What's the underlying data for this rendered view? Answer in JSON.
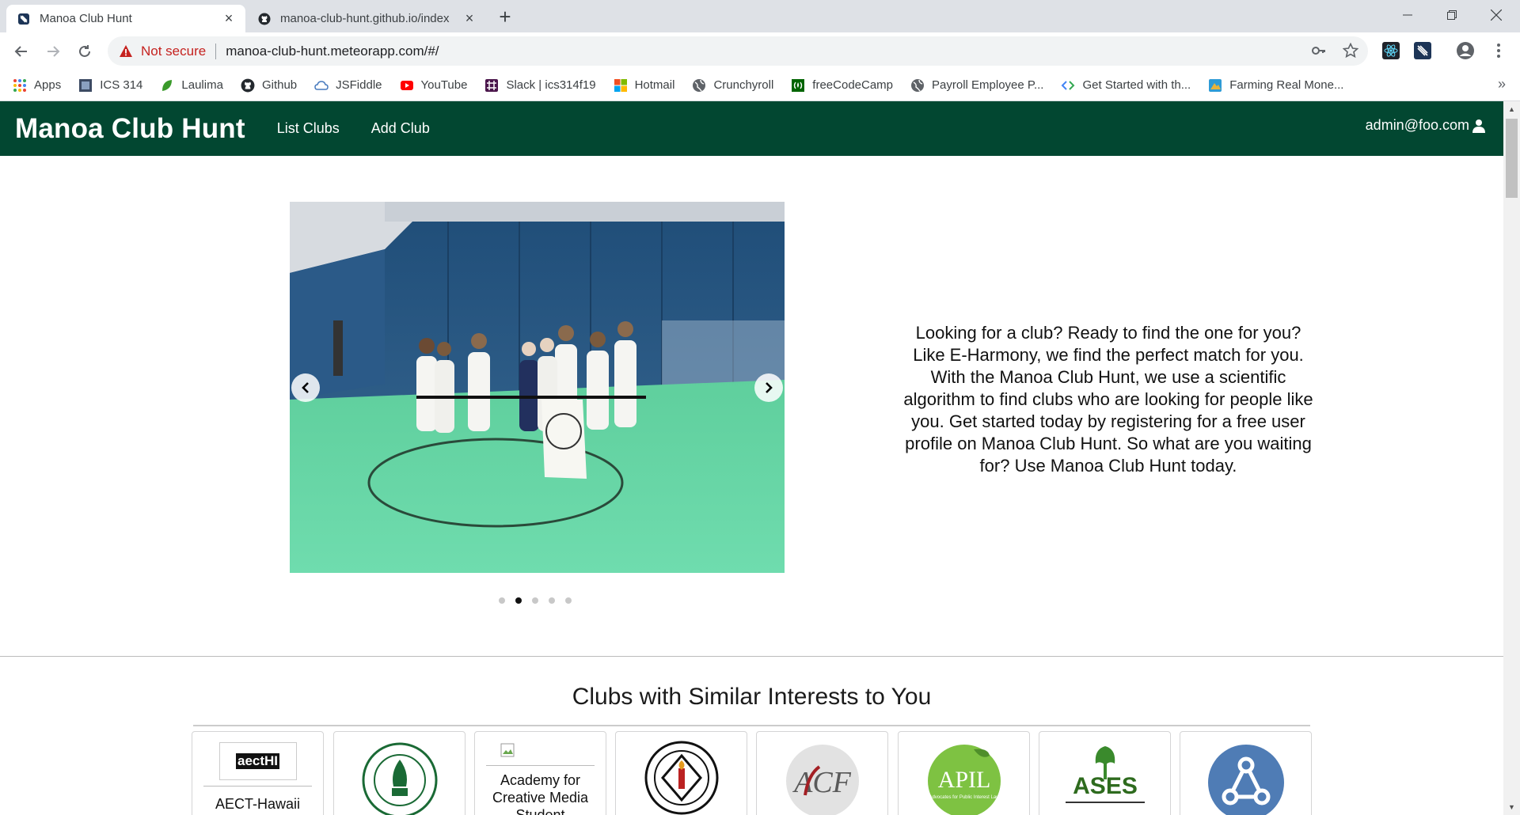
{
  "browser": {
    "tabs": [
      {
        "title": "Manoa Club Hunt",
        "icon": "meteor-favicon-icon",
        "active": true
      },
      {
        "title": "manoa-club-hunt.github.io/index",
        "icon": "github-icon",
        "active": false
      }
    ],
    "address": {
      "security_label": "Not secure",
      "url": "manoa-club-hunt.meteorapp.com/#/"
    },
    "bookmarks": [
      {
        "label": "Apps",
        "icon": "apps-grid-icon"
      },
      {
        "label": "ICS 314",
        "icon": "page-icon"
      },
      {
        "label": "Laulima",
        "icon": "leaf-icon"
      },
      {
        "label": "Github",
        "icon": "github-icon"
      },
      {
        "label": "JSFiddle",
        "icon": "cloud-icon"
      },
      {
        "label": "YouTube",
        "icon": "youtube-icon"
      },
      {
        "label": "Slack | ics314f19",
        "icon": "slack-icon"
      },
      {
        "label": "Hotmail",
        "icon": "microsoft-icon"
      },
      {
        "label": "Crunchyroll",
        "icon": "globe-icon"
      },
      {
        "label": "freeCodeCamp",
        "icon": "fcc-icon"
      },
      {
        "label": "Payroll Employee P...",
        "icon": "globe-icon"
      },
      {
        "label": "Get Started with th...",
        "icon": "code-icon"
      },
      {
        "label": "Farming Real Mone...",
        "icon": "game-icon"
      }
    ],
    "bookmarks_overflow": "»"
  },
  "site": {
    "brand": "Manoa Club Hunt",
    "nav": [
      "List Clubs",
      "Add Club"
    ],
    "user": "admin@foo.com",
    "carousel": {
      "slide_count": 5,
      "active_slide": 2
    },
    "blurb": "Looking for a club? Ready to find the one for you? Like E-Harmony, we find the perfect match for you. With the Manoa Club Hunt, we use a scientific algorithm to find clubs who are looking for people like you. Get started today by registering for a free user profile on Manoa Club Hunt. So what are you waiting for? Use Manoa Club Hunt today.",
    "section_title": "Clubs with Similar Interests to You",
    "clubs": [
      {
        "name": "AECT-Hawaii",
        "logo_text": "aectHI"
      },
      {
        "name": "",
        "logo_text": ""
      },
      {
        "name": "Academy for Creative Media Student",
        "logo_text": ""
      },
      {
        "name": "",
        "logo_text": ""
      },
      {
        "name": "",
        "logo_text": "ACF"
      },
      {
        "name": "",
        "logo_text": "APIL",
        "logo_subtext": "Advocates for Public Interest Law"
      },
      {
        "name": "",
        "logo_text": "ASES"
      },
      {
        "name": "",
        "logo_text": ""
      }
    ]
  },
  "colors": {
    "navbar": "#024731",
    "carousel_floor": "#63d6a6",
    "carousel_wall": "#2f5b87"
  }
}
